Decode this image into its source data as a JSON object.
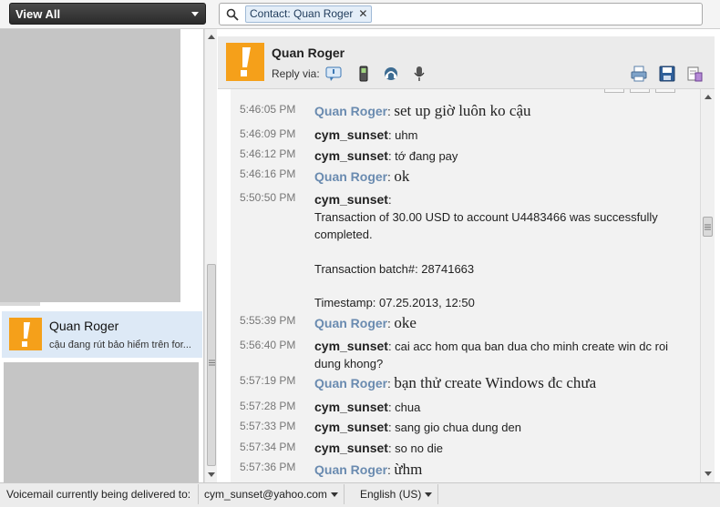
{
  "topbar": {
    "view_label": "View All",
    "search_chip": "Contact: Quan Roger",
    "chip_close": "✕"
  },
  "conversation_list": [
    {
      "name": "Quan Roger",
      "snippet": "cậu đang rút bảo hiểm trên for..."
    }
  ],
  "header": {
    "contact_name": "Quan Roger",
    "reply_label": "Reply via:"
  },
  "messages": [
    {
      "time": "5:46:05 PM",
      "sender": "Quan Roger",
      "text": "set up giờ luôn ko cậu",
      "from": "q"
    },
    {
      "time": "5:46:09 PM",
      "sender": "cym_sunset",
      "text": "uhm",
      "from": "c"
    },
    {
      "time": "5:46:12 PM",
      "sender": "cym_sunset",
      "text": "tớ đang pay",
      "from": "c"
    },
    {
      "time": "5:46:16 PM",
      "sender": "Quan Roger",
      "text": "ok",
      "from": "q"
    },
    {
      "time": "5:50:50 PM",
      "sender": "cym_sunset",
      "text": "",
      "from": "c",
      "lines": [
        "Transaction of 30.00 USD to account U4483466 was successfully completed.",
        "Transaction batch#: 28741663",
        "Timestamp: 07.25.2013, 12:50"
      ]
    },
    {
      "time": "5:55:39 PM",
      "sender": "Quan Roger",
      "text": "oke",
      "from": "q"
    },
    {
      "time": "5:56:40 PM",
      "sender": "cym_sunset",
      "text": "cai acc hom qua ban dua cho minh create win dc roi dung khong?",
      "from": "c"
    },
    {
      "time": "5:57:19 PM",
      "sender": "Quan Roger",
      "text": "bạn thử create Windows đc chưa",
      "from": "q"
    },
    {
      "time": "5:57:28 PM",
      "sender": "cym_sunset",
      "text": "chua",
      "from": "c"
    },
    {
      "time": "5:57:33 PM",
      "sender": "cym_sunset",
      "text": "sang gio chua dung den",
      "from": "c"
    },
    {
      "time": "5:57:34 PM",
      "sender": "cym_sunset",
      "text": "so no die",
      "from": "c"
    },
    {
      "time": "5:57:36 PM",
      "sender": "Quan Roger",
      "text": "ừhm",
      "from": "q"
    }
  ],
  "status_bar": {
    "voicemail_label": "Voicemail currently being delivered to:",
    "voicemail_target": "cym_sunset@yahoo.com",
    "language": "English (US)"
  },
  "colors": {
    "avatar": "#f5a01a",
    "sender_contact": "#6a8bb0",
    "selected_row": "#dde9f6"
  },
  "icons": [
    "search-icon",
    "chip-close-icon",
    "dropdown-caret-icon",
    "alert-avatar-icon",
    "instant-message-icon",
    "mobile-phone-icon",
    "voice-call-icon",
    "microphone-icon",
    "print-icon",
    "save-icon",
    "delete-icon"
  ]
}
